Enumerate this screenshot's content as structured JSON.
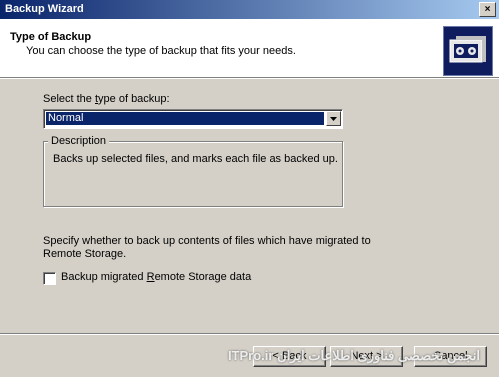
{
  "window": {
    "title": "Backup Wizard",
    "close_glyph": "×"
  },
  "header": {
    "title": "Type of Backup",
    "subtitle": "You can choose the type of backup that fits your needs.",
    "icon": "backup-tape-icon"
  },
  "backup_type": {
    "label_prefix": "Select the ",
    "label_underlined": "t",
    "label_suffix": "ype of backup:",
    "selected": "Normal"
  },
  "description": {
    "legend": "Description",
    "text": "Backs up selected files, and marks each file as backed up."
  },
  "remote_storage": {
    "info": "Specify whether to back up contents of files which have migrated to Remote Storage.",
    "checkbox_label_prefix": "Backup migrated ",
    "checkbox_label_underlined": "R",
    "checkbox_label_suffix": "emote Storage data",
    "checked": false
  },
  "buttons": {
    "back": "< Back",
    "next": "Next >",
    "cancel": "Cancel"
  },
  "watermark": "انجمن تخصصی فناوری اطلاعات ایران ITPro.ir"
}
